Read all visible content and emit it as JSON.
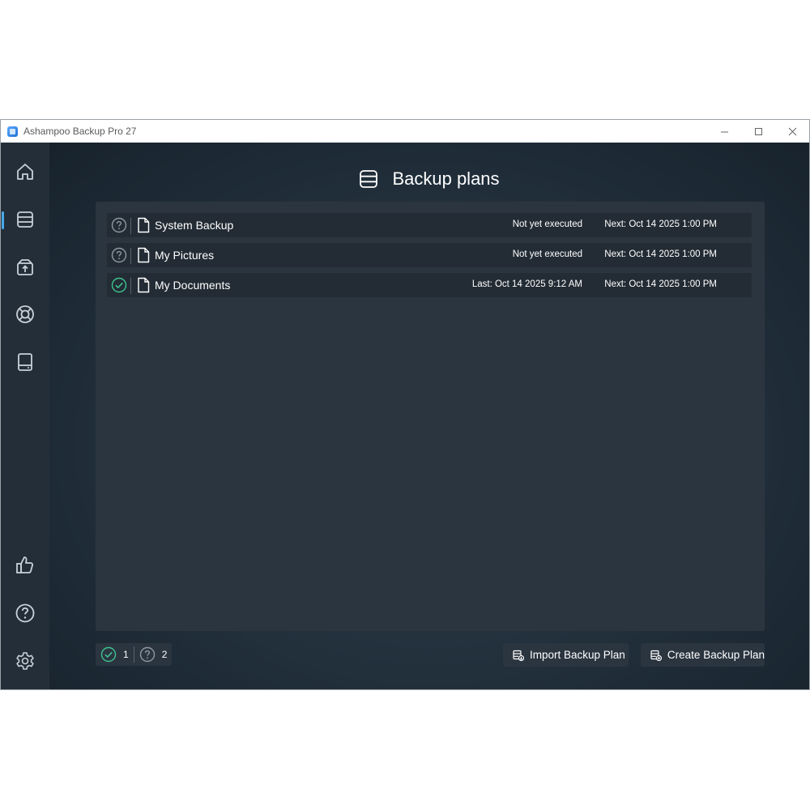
{
  "window": {
    "title": "Ashampoo Backup Pro 27",
    "controls": {
      "minimize": "–",
      "maximize": "☐",
      "close": "✕"
    }
  },
  "sidebar": {
    "active_index": 1,
    "items": [
      {
        "icon": "home-icon"
      },
      {
        "icon": "backup-plans-icon"
      },
      {
        "icon": "restore-icon"
      },
      {
        "icon": "lifebuoy-icon"
      },
      {
        "icon": "drive-icon"
      },
      {
        "icon": "thumbs-up-icon"
      },
      {
        "icon": "help-icon"
      },
      {
        "icon": "settings-icon"
      }
    ]
  },
  "header": {
    "title": "Backup plans",
    "icon": "backup-plans-icon"
  },
  "plans": [
    {
      "name": "System Backup",
      "status": "unknown",
      "last": "Not yet executed",
      "next": "Next: Oct 14  2025  1:00 PM"
    },
    {
      "name": "My Pictures",
      "status": "unknown",
      "last": "Not yet executed",
      "next": "Next: Oct 14  2025  1:00 PM"
    },
    {
      "name": "My Documents",
      "status": "success",
      "last": "Last: Oct 14  2025  9:12 AM",
      "next": "Next: Oct 14  2025  1:00 PM"
    }
  ],
  "footer": {
    "success_count": "1",
    "unknown_count": "2",
    "import_label": "Import Backup Plan",
    "create_label": "Create Backup Plan"
  },
  "colors": {
    "accent": "#4aa8e8",
    "success": "#3ec28f",
    "unknown": "#8e98a2",
    "sidebar_bg": "#232e38",
    "panel_bg": "#2b3540",
    "row_bg": "#232c35"
  }
}
